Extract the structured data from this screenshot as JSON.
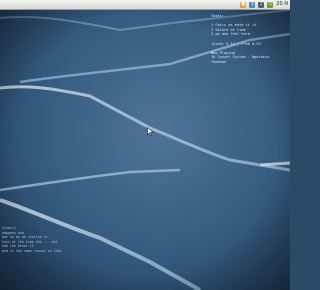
{
  "tray": {
    "icons": [
      {
        "name": "app-icon-orange",
        "color": "#f0a020"
      },
      {
        "name": "network-icon",
        "color": "#4a88c8"
      },
      {
        "name": "volume-icon",
        "color": "#55606b"
      },
      {
        "name": "power-icon",
        "color": "#6a9a3a"
      }
    ],
    "clock": "20 N"
  },
  "conky": {
    "title": "Tasks:",
    "tasks": [
      "1 Fairy as mate it it",
      "2 Secure at time",
      "3 go and feel here"
    ],
    "usage": "(Used) 9.14 / Free 0.93",
    "now_playing_label": "Now Playing",
    "track": "10 Sunset System - Ngoratus",
    "artist": "Yamahan"
  },
  "notes": {
    "lines": [
      "clearly",
      "happens and",
      "",
      "",
      "",
      "Ant to be we realize it",
      "Loss at the time the ... but",
      "nah the other it",
      "and it the same reason so that"
    ]
  }
}
